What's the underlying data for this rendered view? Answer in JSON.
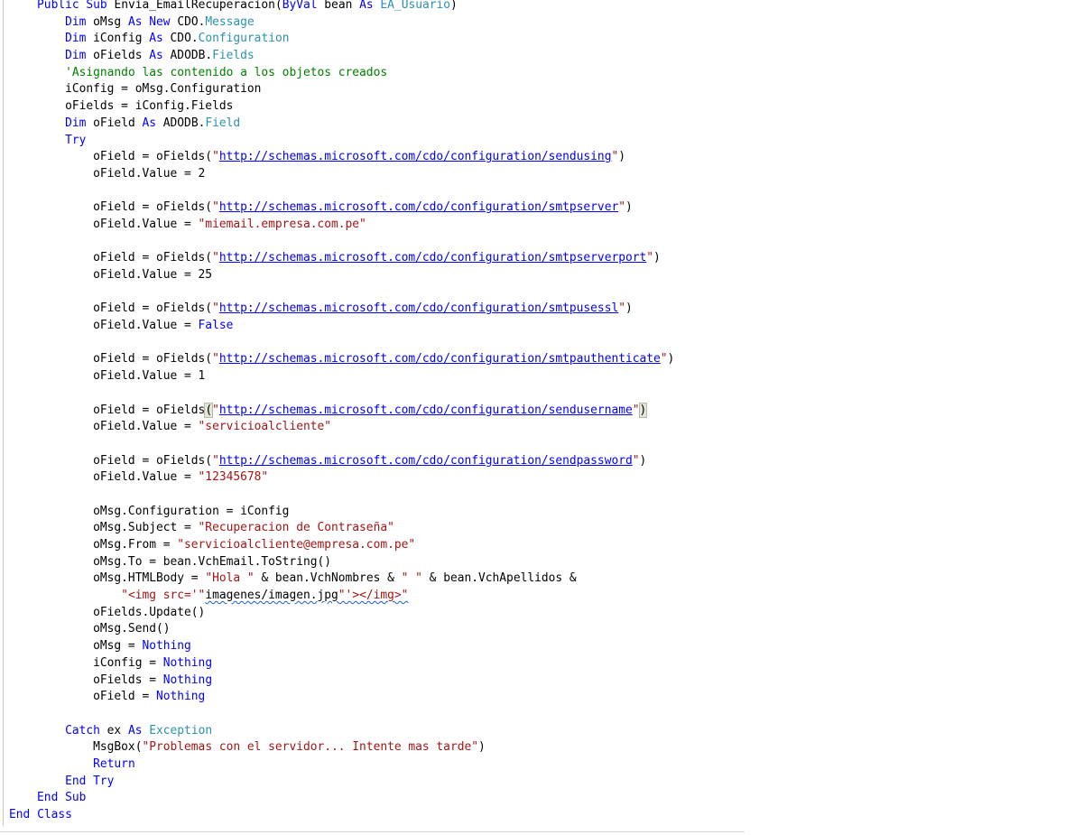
{
  "lines": [
    [
      {
        "t": "    "
      },
      {
        "t": "Public",
        "c": "kw"
      },
      {
        "t": " "
      },
      {
        "t": "Sub",
        "c": "kw"
      },
      {
        "t": " Envia_EmailRecuperacion("
      },
      {
        "t": "ByVal",
        "c": "kw"
      },
      {
        "t": " bean "
      },
      {
        "t": "As",
        "c": "kw"
      },
      {
        "t": " "
      },
      {
        "t": "EA_Usuario",
        "c": "ty"
      },
      {
        "t": ")"
      }
    ],
    [
      {
        "t": "        "
      },
      {
        "t": "Dim",
        "c": "kw"
      },
      {
        "t": " oMsg "
      },
      {
        "t": "As",
        "c": "kw"
      },
      {
        "t": " "
      },
      {
        "t": "New",
        "c": "kw"
      },
      {
        "t": " CDO."
      },
      {
        "t": "Message",
        "c": "ty"
      }
    ],
    [
      {
        "t": "        "
      },
      {
        "t": "Dim",
        "c": "kw"
      },
      {
        "t": " iConfig "
      },
      {
        "t": "As",
        "c": "kw"
      },
      {
        "t": " CDO."
      },
      {
        "t": "Configuration",
        "c": "ty"
      }
    ],
    [
      {
        "t": "        "
      },
      {
        "t": "Dim",
        "c": "kw"
      },
      {
        "t": " oFields "
      },
      {
        "t": "As",
        "c": "kw"
      },
      {
        "t": " ADODB."
      },
      {
        "t": "Fields",
        "c": "ty"
      }
    ],
    [
      {
        "t": "        "
      },
      {
        "t": "'Asignando las contenido a los objetos creados",
        "c": "cm"
      }
    ],
    [
      {
        "t": "        iConfig = oMsg.Configuration"
      }
    ],
    [
      {
        "t": "        oFields = iConfig.Fields"
      }
    ],
    [
      {
        "t": "        "
      },
      {
        "t": "Dim",
        "c": "kw"
      },
      {
        "t": " oField "
      },
      {
        "t": "As",
        "c": "kw"
      },
      {
        "t": " ADODB."
      },
      {
        "t": "Field",
        "c": "ty"
      }
    ],
    [
      {
        "t": "        "
      },
      {
        "t": "Try",
        "c": "kw"
      }
    ],
    [
      {
        "t": "            oField = oFields("
      },
      {
        "t": "\"",
        "c": "str"
      },
      {
        "t": "http://schemas.microsoft.com/cdo/configuration/sendusing",
        "c": "url"
      },
      {
        "t": "\"",
        "c": "str"
      },
      {
        "t": ")"
      }
    ],
    [
      {
        "t": "            oField.Value = 2"
      }
    ],
    [],
    [
      {
        "t": "            oField = oFields("
      },
      {
        "t": "\"",
        "c": "str"
      },
      {
        "t": "http://schemas.microsoft.com/cdo/configuration/smtpserver",
        "c": "url"
      },
      {
        "t": "\"",
        "c": "str"
      },
      {
        "t": ")"
      }
    ],
    [
      {
        "t": "            oField.Value = "
      },
      {
        "t": "\"miemail.empresa.com.pe\"",
        "c": "str"
      }
    ],
    [],
    [
      {
        "t": "            oField = oFields("
      },
      {
        "t": "\"",
        "c": "str"
      },
      {
        "t": "http://schemas.microsoft.com/cdo/configuration/smtpserverport",
        "c": "url"
      },
      {
        "t": "\"",
        "c": "str"
      },
      {
        "t": ")"
      }
    ],
    [
      {
        "t": "            oField.Value = 25"
      }
    ],
    [],
    [
      {
        "t": "            oField = oFields("
      },
      {
        "t": "\"",
        "c": "str"
      },
      {
        "t": "http://schemas.microsoft.com/cdo/configuration/smtpusessl",
        "c": "url"
      },
      {
        "t": "\"",
        "c": "str"
      },
      {
        "t": ")"
      }
    ],
    [
      {
        "t": "            oField.Value = "
      },
      {
        "t": "False",
        "c": "kw"
      }
    ],
    [],
    [
      {
        "t": "            oField = oFields("
      },
      {
        "t": "\"",
        "c": "str"
      },
      {
        "t": "http://schemas.microsoft.com/cdo/configuration/smtpauthenticate",
        "c": "url"
      },
      {
        "t": "\"",
        "c": "str"
      },
      {
        "t": ")"
      }
    ],
    [
      {
        "t": "            oField.Value = 1"
      }
    ],
    [],
    [
      {
        "t": "            oField = oFields"
      },
      {
        "t": "(",
        "c": "br"
      },
      {
        "t": "\"",
        "c": "str"
      },
      {
        "t": "http://schemas.microsoft.com/cdo/configuration/sendusername",
        "c": "url"
      },
      {
        "t": "\"",
        "c": "str"
      },
      {
        "t": ")",
        "c": "br"
      }
    ],
    [
      {
        "t": "            oField.Value = "
      },
      {
        "t": "\"servicioalcliente\"",
        "c": "str"
      }
    ],
    [],
    [
      {
        "t": "            oField = oFields("
      },
      {
        "t": "\"",
        "c": "str"
      },
      {
        "t": "http://schemas.microsoft.com/cdo/configuration/sendpassword",
        "c": "url"
      },
      {
        "t": "\"",
        "c": "str"
      },
      {
        "t": ")"
      }
    ],
    [
      {
        "t": "            oField.Value = "
      },
      {
        "t": "\"12345678\"",
        "c": "str"
      }
    ],
    [],
    [
      {
        "t": "            oMsg.Configuration = iConfig"
      }
    ],
    [
      {
        "t": "            oMsg.Subject = "
      },
      {
        "t": "\"Recuperacion de Contraseña\"",
        "c": "str"
      }
    ],
    [
      {
        "t": "            oMsg.From = "
      },
      {
        "t": "\"servicioalcliente@empresa.com.pe\"",
        "c": "str"
      }
    ],
    [
      {
        "t": "            oMsg.To = bean.VchEmail.ToString()"
      }
    ],
    [
      {
        "t": "            oMsg.HTMLBody = "
      },
      {
        "t": "\"Hola \"",
        "c": "str"
      },
      {
        "t": " & bean.VchNombres & "
      },
      {
        "t": "\" \"",
        "c": "str"
      },
      {
        "t": " & bean.VchApellidos &"
      }
    ],
    [
      {
        "t": "                "
      },
      {
        "t": "\"<img src='\"",
        "c": "str"
      },
      {
        "t": "imagenes/imagen.jpg",
        "c": "sq"
      },
      {
        "t": "\"'></img>\"",
        "c": "str sq"
      }
    ],
    [
      {
        "t": "            oFields.Update()"
      }
    ],
    [
      {
        "t": "            oMsg.Send()"
      }
    ],
    [
      {
        "t": "            oMsg = "
      },
      {
        "t": "Nothing",
        "c": "kw"
      }
    ],
    [
      {
        "t": "            iConfig = "
      },
      {
        "t": "Nothing",
        "c": "kw"
      }
    ],
    [
      {
        "t": "            oFields = "
      },
      {
        "t": "Nothing",
        "c": "kw"
      }
    ],
    [
      {
        "t": "            oField = "
      },
      {
        "t": "Nothing",
        "c": "kw"
      }
    ],
    [],
    [
      {
        "t": "        "
      },
      {
        "t": "Catch",
        "c": "kw"
      },
      {
        "t": " ex "
      },
      {
        "t": "As",
        "c": "kw"
      },
      {
        "t": " "
      },
      {
        "t": "Exception",
        "c": "ty"
      }
    ],
    [
      {
        "t": "            MsgBox("
      },
      {
        "t": "\"Problemas con el servidor... Intente mas tarde\"",
        "c": "str"
      },
      {
        "t": ")"
      }
    ],
    [
      {
        "t": "            "
      },
      {
        "t": "Return",
        "c": "kw"
      }
    ],
    [
      {
        "t": "        "
      },
      {
        "t": "End",
        "c": "kw"
      },
      {
        "t": " "
      },
      {
        "t": "Try",
        "c": "kw"
      }
    ],
    [
      {
        "t": "    "
      },
      {
        "t": "End",
        "c": "kw"
      },
      {
        "t": " "
      },
      {
        "t": "Sub",
        "c": "kw"
      }
    ],
    [
      {
        "t": ""
      },
      {
        "t": "End",
        "c": "kw"
      },
      {
        "t": " "
      },
      {
        "t": "Class",
        "c": "kw"
      }
    ]
  ],
  "colors": {
    "keyword": "#0000ff",
    "type": "#2b91af",
    "string": "#a31515",
    "comment": "#008000",
    "background": "#ffffff",
    "brace_highlight": "#e2e6d6",
    "squiggle": "#1e5bd6"
  }
}
